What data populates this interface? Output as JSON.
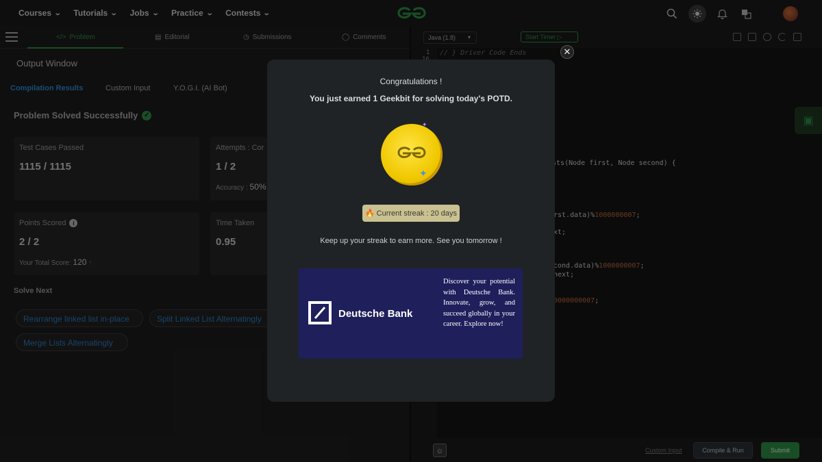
{
  "topnav": {
    "items": [
      "Courses",
      "Tutorials",
      "Jobs",
      "Practice",
      "Contests"
    ],
    "icons": [
      "search-icon",
      "theme-toggle-icon",
      "bell-icon",
      "translate-icon",
      "avatar"
    ]
  },
  "problem_tabs": {
    "problem": "Problem",
    "editorial": "Editorial",
    "submissions": "Submissions",
    "comments": "Comments"
  },
  "output": {
    "title": "Output Window",
    "tabs": [
      "Compilation Results",
      "Custom Input",
      "Y.O.G.I. (AI Bot)"
    ],
    "solved": "Problem Solved Successfully",
    "test_cases_label": "Test Cases Passed",
    "test_cases_value": "1115 / 1115",
    "attempts_label": "Attempts : Cor",
    "attempts_value": "1 / 2",
    "accuracy_label": "Accuracy :",
    "accuracy_value": "50%",
    "points_label": "Points Scored",
    "points_value": "2 / 2",
    "total_score_label": "Your Total Score:",
    "total_score_value": "120",
    "time_label": "Time Taken",
    "time_value": "0.95",
    "solve_next": "Solve Next",
    "next_problems": [
      "Rearrange linked list in-place",
      "Split Linked List Alternatingly",
      "Merge Lists Alternatingly"
    ]
  },
  "editor": {
    "language": "Java (1.8)",
    "timer": "Start Timer",
    "line_numbers": [
      "1",
      "16"
    ],
    "code_lines": [
      {
        "text": "// } Driver Code Ends",
        "kind": "cmt"
      },
      {
        "text": "ists(Node first, Node second) {",
        "kind": "plain"
      },
      {
        "pre": "rst.data)%",
        "num": "1000000007",
        "post": ";"
      },
      {
        "text": "xt;",
        "kind": "plain"
      },
      {
        "pre": "cond.data)%",
        "num": "1000000007",
        "post": ";"
      },
      {
        "text": "next;",
        "kind": "plain"
      },
      {
        "pre": "",
        "num": "0000000007",
        "post": ";"
      }
    ],
    "custom_input": "Custom Input",
    "compile_run": "Compile & Run",
    "submit": "Submit"
  },
  "modal": {
    "title": "Congratulations !",
    "earned": "You just earned 1 Geekbit for solving today's POTD.",
    "streak": "Current streak : 20 days",
    "keepup": "Keep up your streak to earn more. See you tomorrow !",
    "ad": {
      "brand": "Deutsche Bank",
      "text": "Discover your potential with Deutsche Bank. Innovate, grow, and succeed globally in your career. Explore now!"
    }
  },
  "colors": {
    "brand_green": "#2f8d46",
    "link_blue": "#2e7bc2",
    "coin_gold": "#f0c800",
    "ad_bg": "#1f1f5c"
  }
}
